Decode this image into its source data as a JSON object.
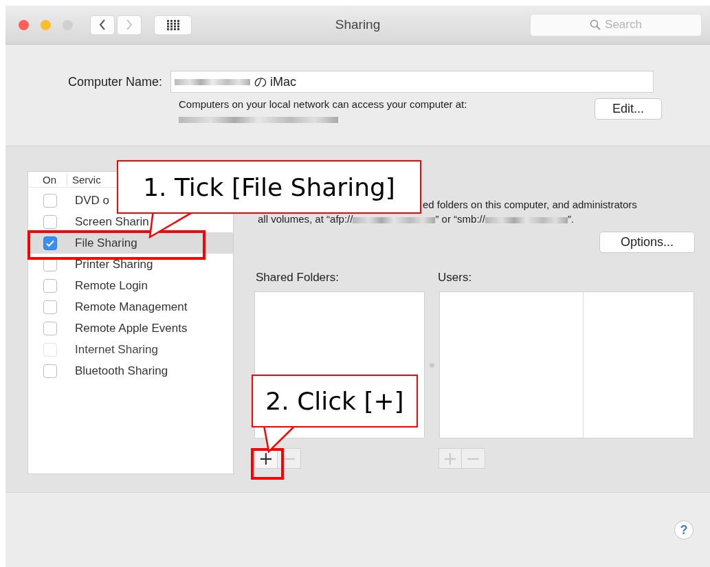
{
  "window": {
    "title": "Sharing",
    "search_placeholder": "Search"
  },
  "computer_name": {
    "label": "Computer Name:",
    "value": "の iMac",
    "note": "Computers on your local network can access your computer at:",
    "edit_button": "Edit..."
  },
  "services": {
    "columns": [
      "On",
      "Servic"
    ],
    "items": [
      {
        "name": "DVD o",
        "checked": false,
        "selected": false,
        "disabled": false
      },
      {
        "name": "Screen Sharin",
        "checked": false,
        "selected": false,
        "disabled": false
      },
      {
        "name": "File Sharing",
        "checked": true,
        "selected": true,
        "disabled": false
      },
      {
        "name": "Printer Sharing",
        "checked": false,
        "selected": false,
        "disabled": false
      },
      {
        "name": "Remote Login",
        "checked": false,
        "selected": false,
        "disabled": false
      },
      {
        "name": "Remote Management",
        "checked": false,
        "selected": false,
        "disabled": false
      },
      {
        "name": "Remote Apple Events",
        "checked": false,
        "selected": false,
        "disabled": false
      },
      {
        "name": "Internet Sharing",
        "checked": false,
        "selected": false,
        "disabled": true
      },
      {
        "name": "Bluetooth Sharing",
        "checked": false,
        "selected": false,
        "disabled": false
      }
    ]
  },
  "detail": {
    "description_line": "ed folders on this computer, and administrators",
    "address_parts": [
      "all volumes, at “afp://",
      "” or “smb://",
      "”."
    ],
    "options_button": "Options...",
    "shared_folders": {
      "label": "Shared Folders:",
      "add": {
        "text": "+",
        "disabled": false
      },
      "remove": {
        "text": "−",
        "disabled": true
      }
    },
    "users": {
      "label": "Users:",
      "add": {
        "text": "+",
        "disabled": true
      },
      "remove": {
        "text": "−",
        "disabled": true
      }
    }
  },
  "help_button": "?",
  "callouts": [
    {
      "text": "1. Tick [File Sharing]"
    },
    {
      "text": "2. Click [+]"
    }
  ]
}
